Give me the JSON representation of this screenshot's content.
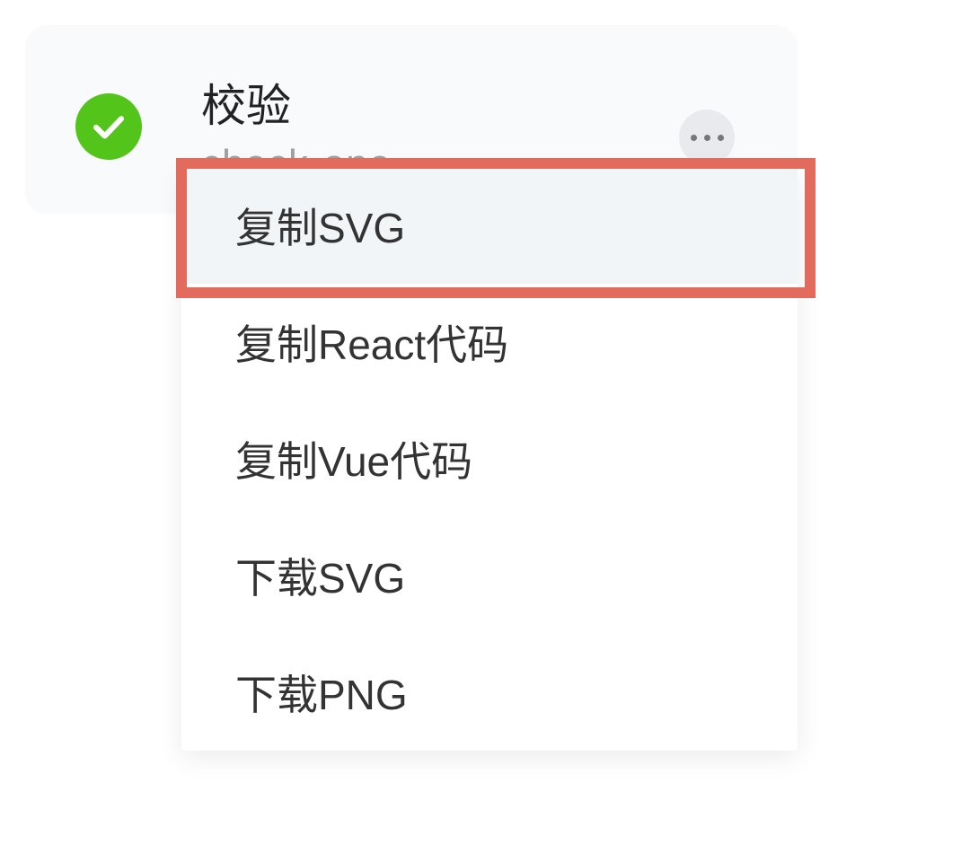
{
  "icon": {
    "name": "校验",
    "slug": "check-one"
  },
  "menu": {
    "items": [
      {
        "label": "复制SVG",
        "hovered": true
      },
      {
        "label": "复制React代码",
        "hovered": false
      },
      {
        "label": "复制Vue代码",
        "hovered": false
      },
      {
        "label": "下载SVG",
        "hovered": false
      },
      {
        "label": "下载PNG",
        "hovered": false
      }
    ]
  },
  "colors": {
    "check_green": "#52c41a",
    "card_bg": "#f8fafc",
    "highlight_border": "#e36b5d",
    "menu_hover": "#f2f5f8"
  }
}
